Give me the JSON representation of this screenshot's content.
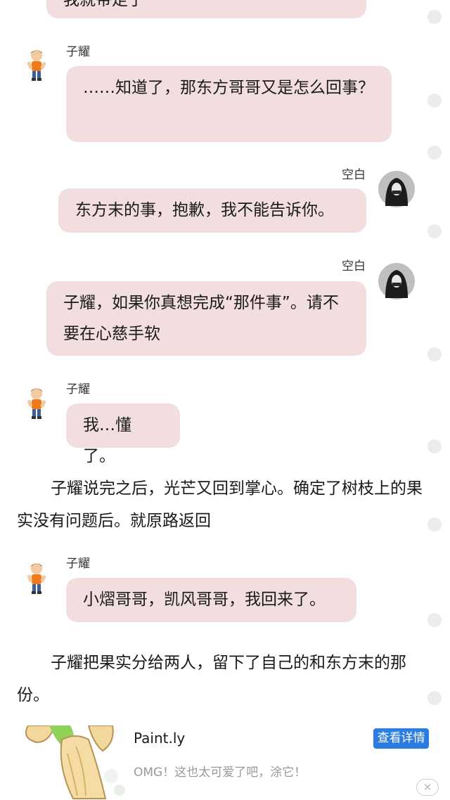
{
  "messages": [
    {
      "name": "",
      "text": "我就带走了"
    },
    {
      "name": "子耀",
      "text": "……知道了，那东方哥哥又是怎么回事？"
    },
    {
      "name": "空白",
      "text": "东方末的事，抱歉，我不能告诉你。"
    },
    {
      "name": "空白",
      "text": "子耀，如果你真想完成“那件事”。请不要在心慈手软"
    },
    {
      "name": "子耀",
      "text": "我…懂了。"
    },
    {
      "name": "子耀",
      "text": "小熠哥哥，凯风哥哥，我回来了。"
    }
  ],
  "paragraphs": [
    "子耀说完之后，光芒又回到掌心。确定了树枝上的果实没有问题后。就原路返回",
    "子耀把果实分给两人，留下了自己的和东方末的那份。"
  ],
  "ad": {
    "title": "Paint.ly",
    "description": "OMG！这也太可爱了吧，涂它！",
    "button_label": "查看详情",
    "close_label": "✕"
  },
  "icons": {
    "avatar_ziyao": "cartoon-boy-avatar-icon",
    "avatar_kongbai": "hooded-figure-avatar-icon",
    "ad_close": "close-icon"
  },
  "colors": {
    "bubble": "#f2dede",
    "ad_button": "#2a7ce0",
    "background": "#ffffff"
  }
}
